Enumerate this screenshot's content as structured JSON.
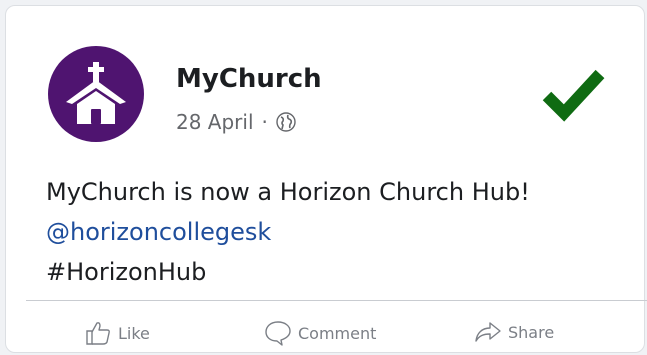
{
  "post": {
    "author": "MyChurch",
    "date": "28 April",
    "separator": "·",
    "audience_icon": "globe-icon",
    "verified_icon": "checkmark-icon",
    "text_line1": "MyChurch is now a Horizon Church Hub!",
    "mention": "@horizoncollegesk",
    "hashtag": "#HorizonHub"
  },
  "actions": {
    "like_label": "Like",
    "comment_label": "Comment",
    "share_label": "Share"
  },
  "colors": {
    "avatar_bg": "#4f1470",
    "check": "#0f6b12",
    "link": "#1f4e9c"
  }
}
